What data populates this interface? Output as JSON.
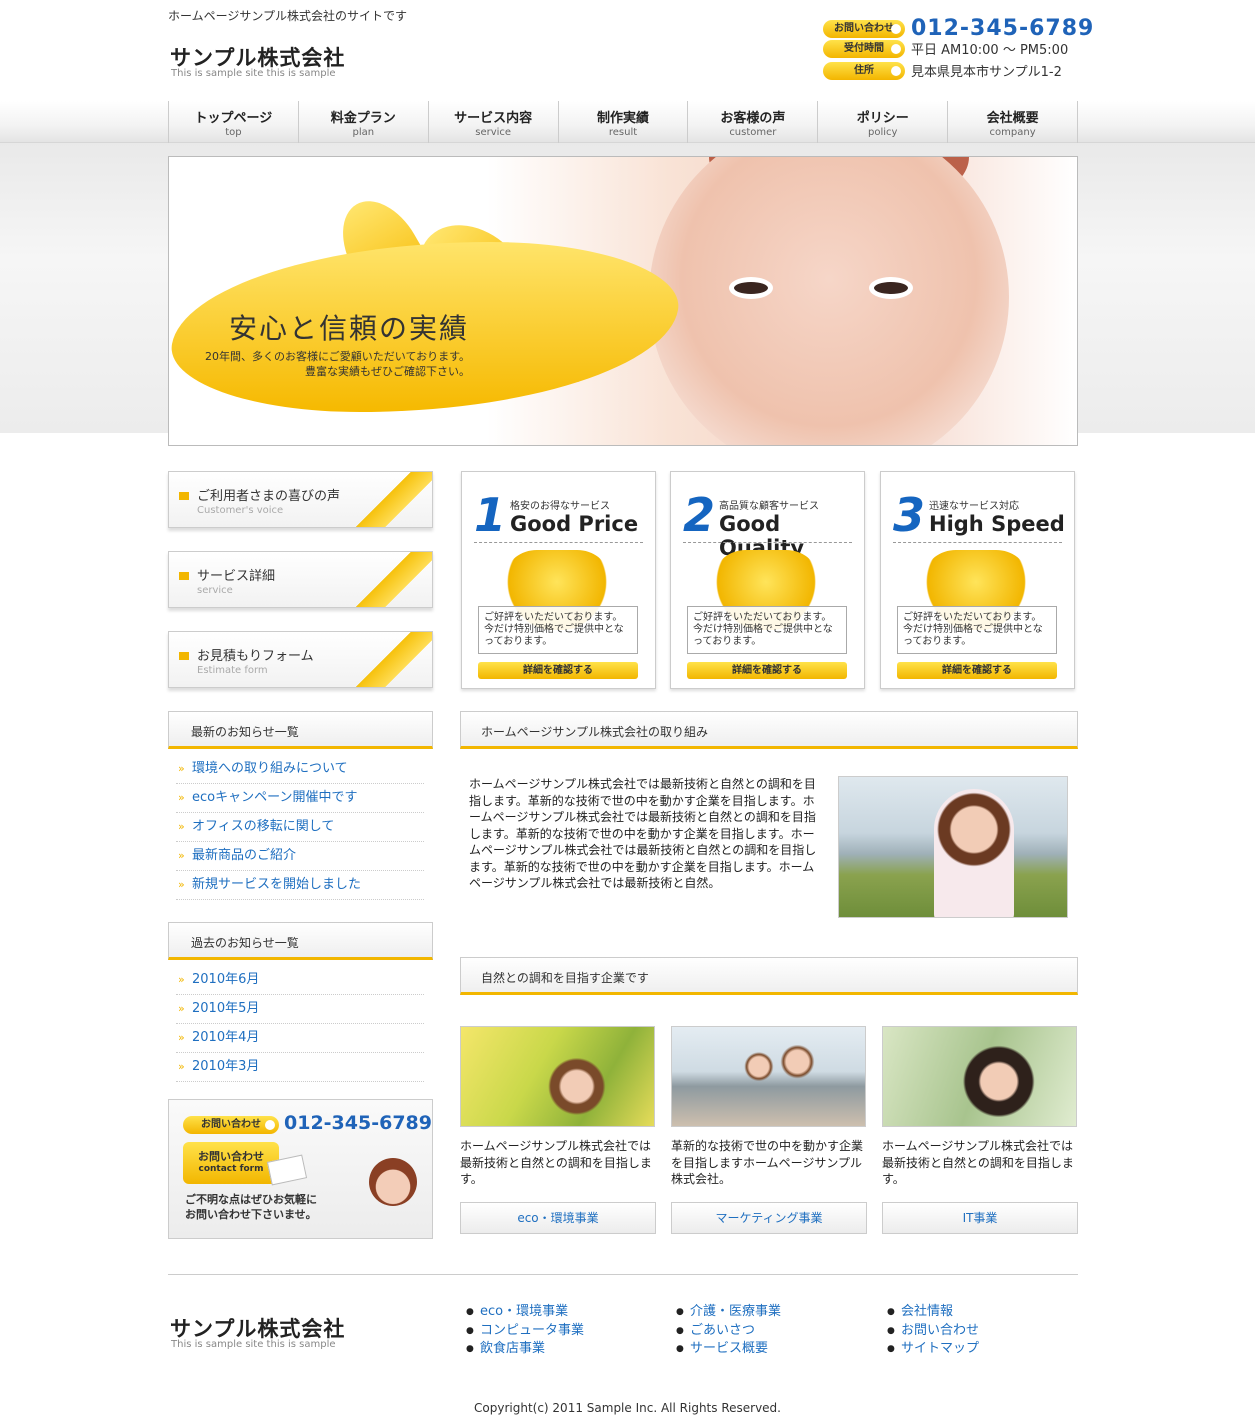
{
  "header": {
    "tagline": "ホームページサンプル株式会社のサイトです",
    "logo": "サンプル株式会社",
    "logo_sub": "This is sample site this is sample",
    "contact_label": "お問い合わせ",
    "phone": "012-345-6789",
    "hours_label": "受付時間",
    "hours": "平日 AM10:00 ～ PM5:00",
    "address_label": "住所",
    "address": "見本県見本市サンプル1-2"
  },
  "nav": [
    {
      "jp": "トップページ",
      "en": "top"
    },
    {
      "jp": "料金プラン",
      "en": "plan"
    },
    {
      "jp": "サービス内容",
      "en": "service"
    },
    {
      "jp": "制作実績",
      "en": "result"
    },
    {
      "jp": "お客様の声",
      "en": "customer"
    },
    {
      "jp": "ポリシー",
      "en": "policy"
    },
    {
      "jp": "会社概要",
      "en": "company"
    }
  ],
  "hero": {
    "title": "安心と信頼の実績",
    "sub1": "20年間、多くのお客様にご愛顧いただいております。",
    "sub2": "豊富な実績もぜひご確認下さい。"
  },
  "side_buttons": [
    {
      "jp": "ご利用者さまの喜びの声",
      "en": "Customer's voice"
    },
    {
      "jp": "サービス詳細",
      "en": "service"
    },
    {
      "jp": "お見積もりフォーム",
      "en": "Estimate form"
    }
  ],
  "news": {
    "title": "最新のお知らせ一覧",
    "items": [
      "環境への取り組みについて",
      "ecoキャンペーン開催中です",
      "オフィスの移転に関して",
      "最新商品のご紹介",
      "新規サービスを開始しました"
    ]
  },
  "archive": {
    "title": "過去のお知らせ一覧",
    "items": [
      "2010年6月",
      "2010年5月",
      "2010年4月",
      "2010年3月"
    ]
  },
  "inquiry": {
    "label": "お問い合わせ",
    "phone": "012-345-6789",
    "form_jp": "お問い合わせ",
    "form_en": "contact form",
    "note1": "ご不明な点はぜひお気軽に",
    "note2": "お問い合わせ下さいませ。"
  },
  "features": [
    {
      "num": "1",
      "small": "格安のお得なサービス",
      "big": "Good Price",
      "text": "ご好評をいただいております。今だけ特別価格でご提供中となっております。",
      "button": "詳細を確認する"
    },
    {
      "num": "2",
      "small": "高品質な顧客サービス",
      "big": "Good Quality",
      "text": "ご好評をいただいております。今だけ特別価格でご提供中となっております。",
      "button": "詳細を確認する"
    },
    {
      "num": "3",
      "small": "迅速なサービス対応",
      "big": "High Speed",
      "text": "ご好評をいただいております。今だけ特別価格でご提供中となっております。",
      "button": "詳細を確認する"
    }
  ],
  "section1": {
    "title": "ホームページサンプル株式会社の取り組み",
    "body": "ホームページサンプル株式会社では最新技術と自然との調和を目指します。革新的な技術で世の中を動かす企業を目指します。ホームページサンプル株式会社では最新技術と自然との調和を目指します。革新的な技術で世の中を動かす企業を目指します。ホームページサンプル株式会社では最新技術と自然との調和を目指します。革新的な技術で世の中を動かす企業を目指します。ホームページサンプル株式会社では最新技術と自然。"
  },
  "section2": {
    "title": "自然との調和を目指す企業です",
    "cols": [
      {
        "text": "ホームページサンプル株式会社では最新技術と自然との調和を目指します。",
        "button": "eco・環境事業"
      },
      {
        "text": "革新的な技術で世の中を動かす企業を目指しますホームページサンプル株式会社。",
        "button": "マーケティング事業"
      },
      {
        "text": "ホームページサンプル株式会社では最新技術と自然との調和を目指します。",
        "button": "IT事業"
      }
    ]
  },
  "footer": {
    "logo": "サンプル株式会社",
    "logo_sub": "This is sample site this is sample",
    "links1": [
      "eco・環境事業",
      "コンピュータ事業",
      "飲食店事業"
    ],
    "links2": [
      "介護・医療事業",
      "ごあいさつ",
      "サービス概要"
    ],
    "links3": [
      "会社情報",
      "お問い合わせ",
      "サイトマップ"
    ],
    "copyright": "Copyright(c) 2011 Sample Inc. All Rights Reserved."
  },
  "colors": {
    "accent": "#f2b600",
    "link": "#1f6fc0",
    "phone": "#1f63b8"
  }
}
